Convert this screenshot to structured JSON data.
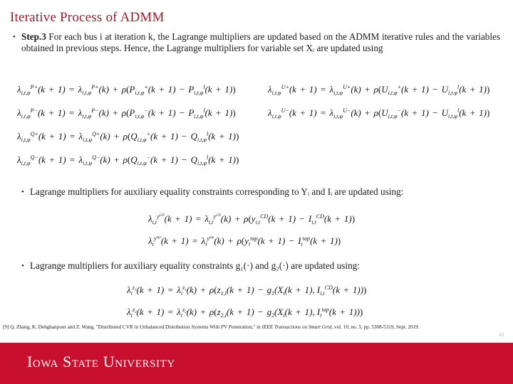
{
  "slide": {
    "title": "Iterative Process of ADMM",
    "page_number": "41",
    "title_color": "#9d1c28",
    "brand_band_color": "#c8102e"
  },
  "bullets": [
    {
      "marker": "•",
      "lead": "Step.3",
      "text": " For each bus i at iteration k, the Lagrange multipliers are updated based on the ADMM iterative rules and the variables obtained in previous steps. Hence, the Lagrange multipliers for variable set Xᵢ are updated using"
    },
    {
      "marker": "•",
      "text": "Lagrange multipliers for auxiliary equality constraints corresponding to Yᵢ and Iᵢ are updated using:"
    },
    {
      "marker": "•",
      "text": "Lagrange multipliers for auxiliary equality constraints g₁(·) and g₂(·) are updated using:"
    }
  ],
  "equations": {
    "block1": [
      {
        "left": "λᵢ,ₜ,φ^{P+}(k + 1) = λᵢ,ₜ,φ^{P+}(k) + ρ(Pᵢ,ₜ,φ^{+}(k + 1) − Pᵢ,ₜ,φ^{l}(k + 1))",
        "right": "λᵢ,ₜ,φ^{U+}(k + 1) = λᵢ,ₜ,φ^{U+}(k) + ρ(Uᵢ,ₜ,φ^{+}(k + 1) − Uᵢ,ₜ,φ^{l}(k + 1))"
      },
      {
        "left": "λᵢ,ₜ,φ^{P−}(k + 1) = λᵢ,ₜ,φ^{P−}(k) + ρ(Pᵢ,ₜ,φ^{−}(k + 1) − Pᵢ,ₜ,φ^{l}(k + 1))",
        "right": "λᵢ,ₜ,φ^{U−}(k + 1) = λᵢ,ₜ,φ^{U−}(k) + ρ(Uᵢ,ₜ,φ^{−}(k + 1) − Uᵢ,ₜ,φ^{l}(k + 1))"
      },
      {
        "left": "λᵢ,ₜ,φ^{Q+}(k + 1) = λᵢ,ₜ,φ^{Q+}(k) + ρ(Qᵢ,ₜ,φ^{+}(k + 1) − Qᵢ,ₜ,φ^{l}(k + 1))",
        "right": ""
      },
      {
        "left": "λᵢ,ₜ,φ^{Q−}(k + 1) = λᵢ,ₜ,φ^{Q−}(k) + ρ(Qᵢ,ₜ,φ^{−}(k + 1) − Qᵢ,ₜ,φ^{l}(k + 1))",
        "right": ""
      }
    ],
    "block2": [
      "λᵢ,ₜ^{y^{CD}}(k + 1) = λᵢ,ₜ^{y^{CD}}(k) + ρ(yᵢ,ₜ^{CD}(k + 1) − Iᵢ,ₜ^{CD}(k + 1))",
      "λₜ^{y^{tap}}(k + 1) = λₜ^{y^{tap}}(k) + ρ(yₜ^{tap}(k + 1) − Iₜ^{tap}(k + 1))"
    ],
    "block3": [
      "λᵢ^{z₁}(k + 1) = λᵢ^{z₁}(k) + ρ(z₁,ᵢ(k + 1) − g₁(Xᵢ(k + 1), Iᵢ,ₜ^{CD}(k + 1)))",
      "λᵢ^{z₂}(k + 1) = λᵢ^{z₂}(k) + ρ(z₂,ᵢ(k + 1) − g₂(Xᵢ(k + 1), Iₜ^{tap}(k + 1)))"
    ]
  },
  "citation": {
    "line1_pre": "[9] Q. Zhang, K. Dehghanpour and Z. Wang, \"Distributed CVR in Unbalanced Distribution Systems With PV Penetration,\" in ",
    "line1_italic": "IEEE Transactions on Smart Grid",
    "line1_post": ", vol. 10, no. 5, pp. 5308-5319, Sept. 2019."
  },
  "branding": {
    "wordmark": "Iowa State University"
  }
}
